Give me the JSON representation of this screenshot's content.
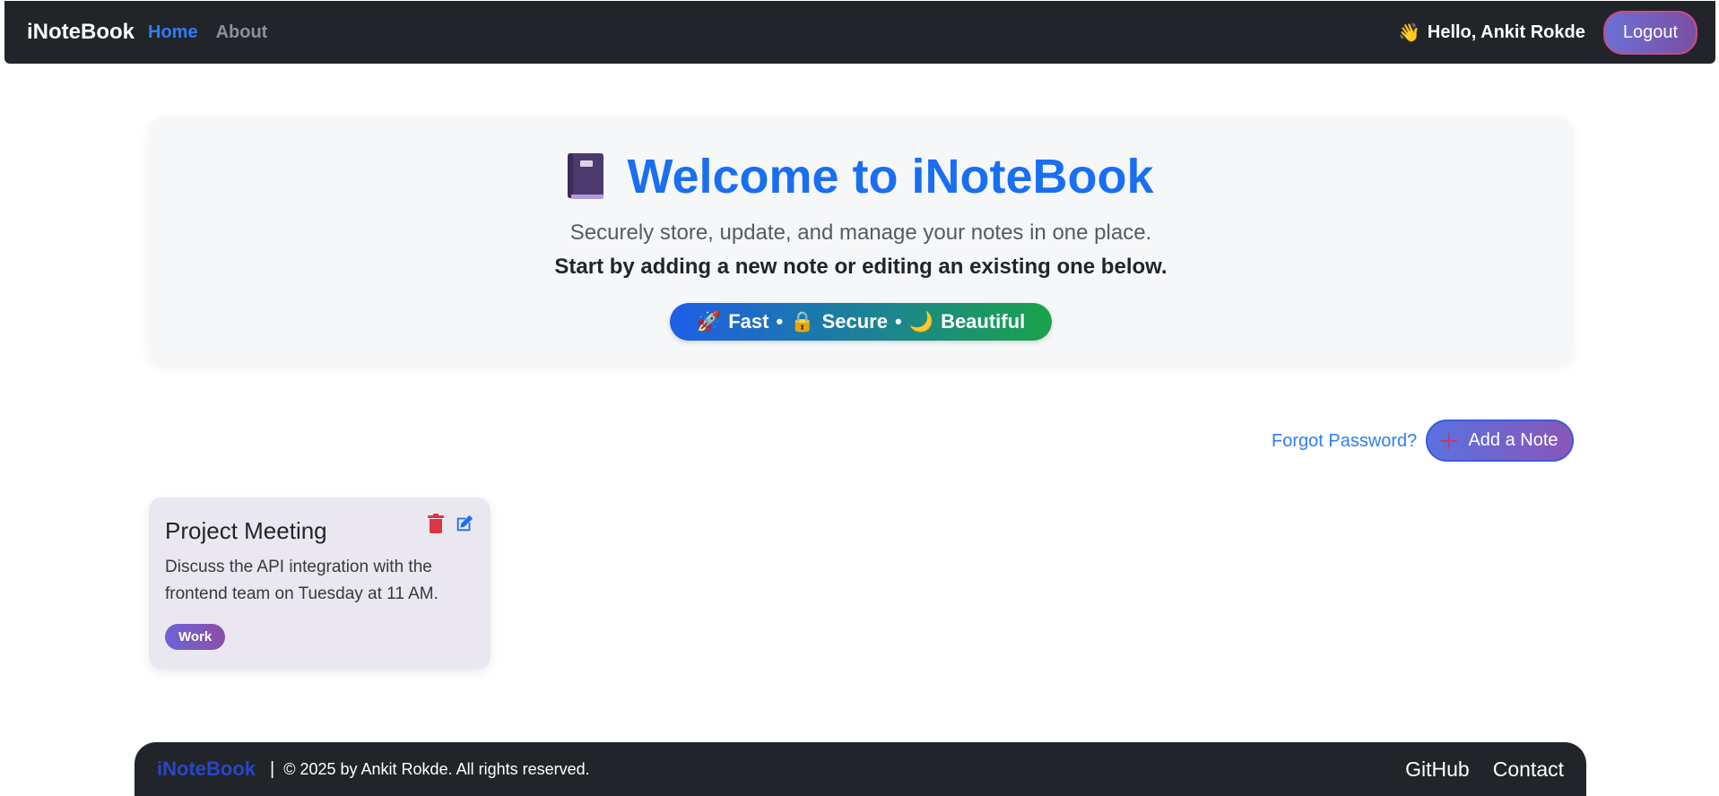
{
  "navbar": {
    "brand": "iNoteBook",
    "links": [
      {
        "label": "Home"
      },
      {
        "label": "About"
      }
    ],
    "greeting_icon": "👋",
    "greeting": "Hello, Ankit Rokde",
    "logout_label": "Logout"
  },
  "hero": {
    "title": "Welcome to iNoteBook",
    "title_icon": "notebook-icon",
    "subtitle": "Securely store, update, and manage your notes in one place.",
    "subtitle2": "Start by adding a new note or editing an existing one below.",
    "pill": {
      "items": [
        {
          "icon": "🚀",
          "label": "Fast"
        },
        {
          "icon": "🔒",
          "label": "Secure"
        },
        {
          "icon": "🌙",
          "label": "Beautiful"
        }
      ],
      "separator": "•"
    }
  },
  "actions": {
    "forgot_password": "Forgot Password?",
    "add_note": "Add a Note"
  },
  "notes": [
    {
      "title": "Project Meeting",
      "description": "Discuss the API integration with the frontend team on Tuesday at 11 AM.",
      "tag": "Work"
    }
  ],
  "footer": {
    "brand": "iNoteBook",
    "separator": "|",
    "copyright": "© 2025 by Ankit Rokde. All rights reserved.",
    "links": [
      {
        "label": "GitHub"
      },
      {
        "label": "Contact"
      }
    ]
  },
  "colors": {
    "navbar_bg": "#212529",
    "accent_blue": "#1a6ff0",
    "danger": "#dc3545",
    "hero_bg": "#f6f7f9",
    "note_bg": "#ebe7f1"
  }
}
